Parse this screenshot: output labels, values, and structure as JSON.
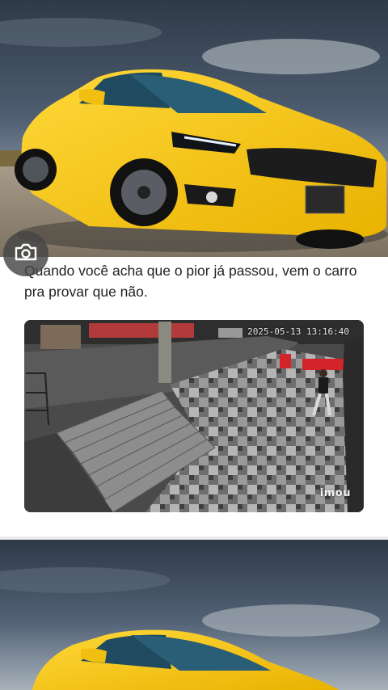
{
  "post": {
    "caption": "Quando você acha que o pior já passou, vem o carro pra provar que não.",
    "video": {
      "timestamp": "2025-05-13 13:16:40",
      "watermark": "imou"
    }
  },
  "icons": {
    "camera": "camera-icon"
  },
  "colors": {
    "car_yellow": "#f4c20d",
    "sky_dark": "#3b4656",
    "caption_text": "#222222"
  }
}
